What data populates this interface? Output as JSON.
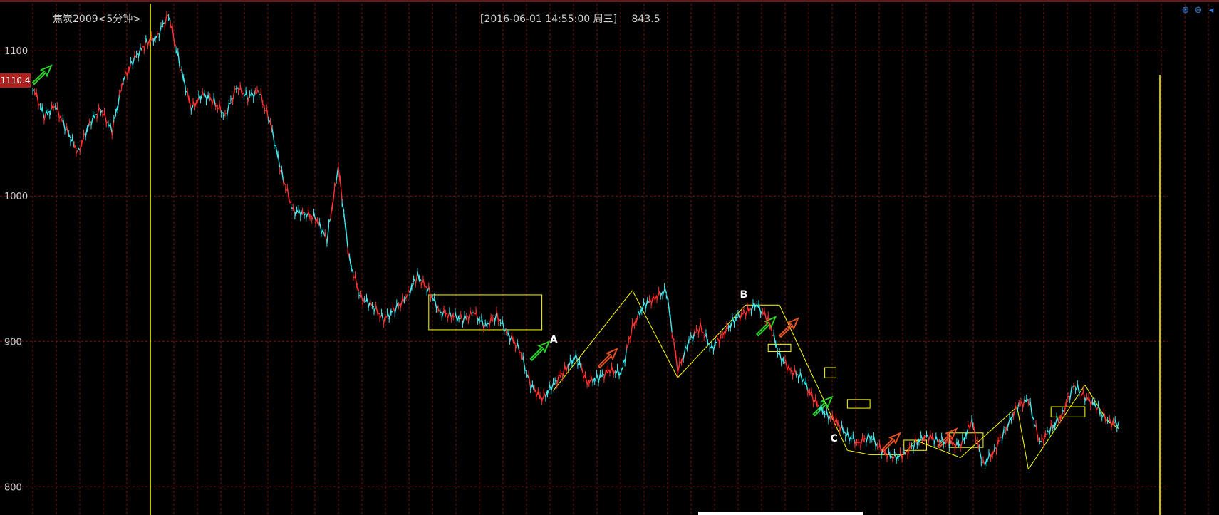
{
  "header": {
    "title": "焦炭2009<5分钟>",
    "cursor_datetime": "[2016-06-01  14:55:00 周三]",
    "cursor_price": "843.5",
    "last_price_tag": "1110.4"
  },
  "toolbar": {
    "zoom_in_icon": "zoom-in-icon",
    "zoom_out_icon": "zoom-out-icon",
    "arrow_icon": "arrow-left-icon"
  },
  "colors": {
    "up": "#ff3030",
    "down": "#40e8ec",
    "grid": "#7a1515",
    "annotation": "#ffff00",
    "axis_text": "#cccccc"
  },
  "chart_data": {
    "type": "line",
    "title": "焦炭2009<5分钟>",
    "xlabel": "",
    "ylabel": "",
    "ylim": [
      782,
      1130
    ],
    "y_ticks": [
      800,
      900,
      1000,
      1100
    ],
    "grid": true,
    "x_index_range": [
      0,
      100
    ],
    "series": [
      {
        "x": [
          0,
          1,
          2,
          3,
          4,
          5,
          6,
          7,
          8,
          9,
          10,
          11,
          12,
          13,
          14,
          15,
          16,
          17,
          18,
          19,
          20,
          21,
          22,
          23,
          24,
          25,
          26,
          27,
          28,
          29,
          30,
          31,
          32,
          33,
          34,
          35,
          36,
          37,
          38,
          39,
          40,
          41,
          42,
          43,
          44,
          45,
          46,
          47,
          48,
          49,
          50,
          51,
          52,
          53,
          54,
          55,
          56,
          57,
          58,
          59,
          60,
          61,
          62,
          63,
          64,
          65,
          66,
          67,
          68,
          69,
          70,
          71,
          72,
          73,
          74,
          75,
          76,
          77,
          78,
          79,
          80,
          81,
          82,
          83,
          84,
          85,
          86,
          87,
          88,
          89,
          90,
          91,
          92,
          93,
          94,
          95,
          96
        ],
        "values": [
          1075,
          1055,
          1062,
          1045,
          1030,
          1050,
          1060,
          1045,
          1080,
          1095,
          1105,
          1110,
          1125,
          1090,
          1060,
          1070,
          1065,
          1055,
          1075,
          1068,
          1072,
          1050,
          1015,
          990,
          988,
          985,
          970,
          1020,
          955,
          930,
          925,
          915,
          922,
          930,
          945,
          935,
          920,
          918,
          915,
          920,
          910,
          918,
          905,
          895,
          870,
          860,
          870,
          880,
          890,
          872,
          875,
          880,
          878,
          910,
          925,
          930,
          935,
          880,
          900,
          910,
          895,
          905,
          915,
          920,
          925,
          915,
          890,
          880,
          875,
          860,
          850,
          845,
          835,
          830,
          835,
          825,
          820,
          822,
          830,
          835,
          832,
          830,
          828,
          845,
          815,
          825,
          840,
          855,
          860,
          830,
          840,
          850,
          870,
          862,
          855,
          845,
          843
        ]
      }
    ],
    "annotations": [
      "A",
      "B",
      "C"
    ]
  }
}
